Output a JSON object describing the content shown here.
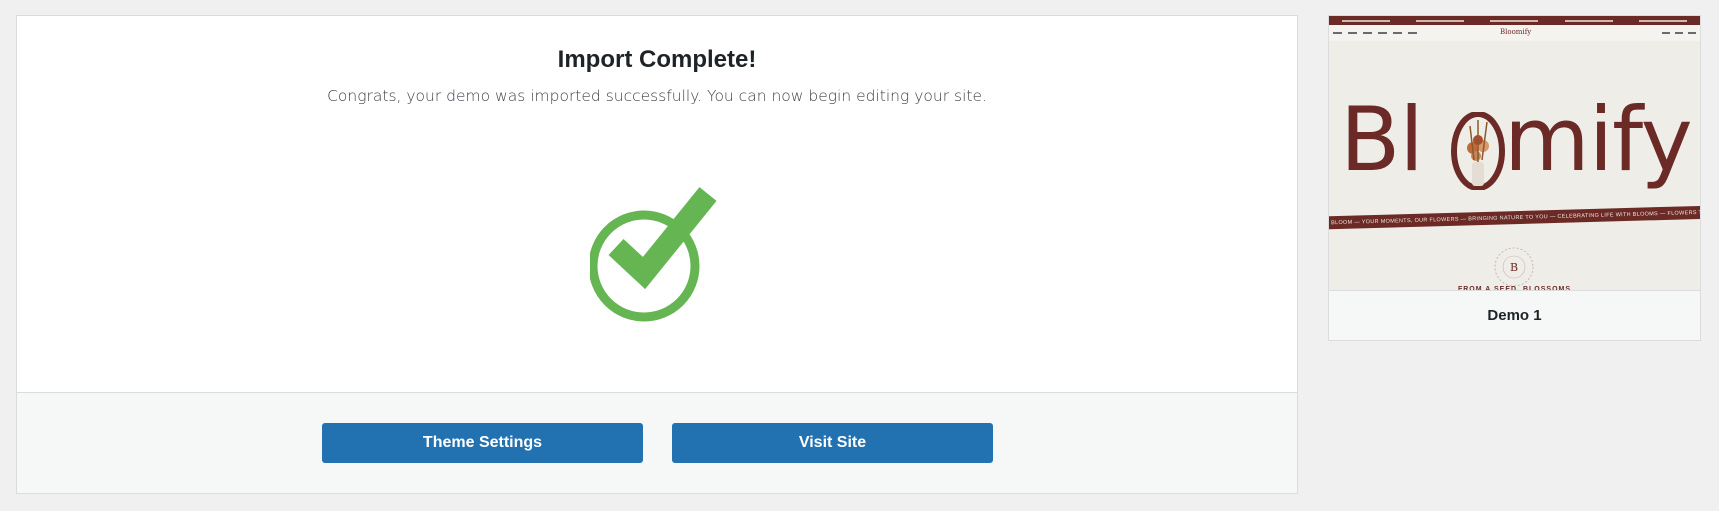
{
  "main": {
    "title": "Import Complete!",
    "subtitle": "Congrats, your demo was imported successfully. You can now begin editing your site.",
    "success_color": "#66b553",
    "buttons": {
      "theme_settings": "Theme Settings",
      "visit_site": "Visit Site"
    },
    "button_color": "#2271b1"
  },
  "demo": {
    "name": "Demo 1",
    "preview": {
      "logo": "Bloomify",
      "brand": "Blmify",
      "ribbon": "BLOOM — YOUR MOMENTS, OUR FLOWERS — BRINGING NATURE TO YOU — CELEBRATING LIFE WITH BLOOMS — FLOWERS THAT TOUCH HEARTS — ELEGAN",
      "badge_letter": "B",
      "tagline": "FROM A SEED, BLOSSOMS",
      "accent_color": "#6b2a26"
    }
  }
}
